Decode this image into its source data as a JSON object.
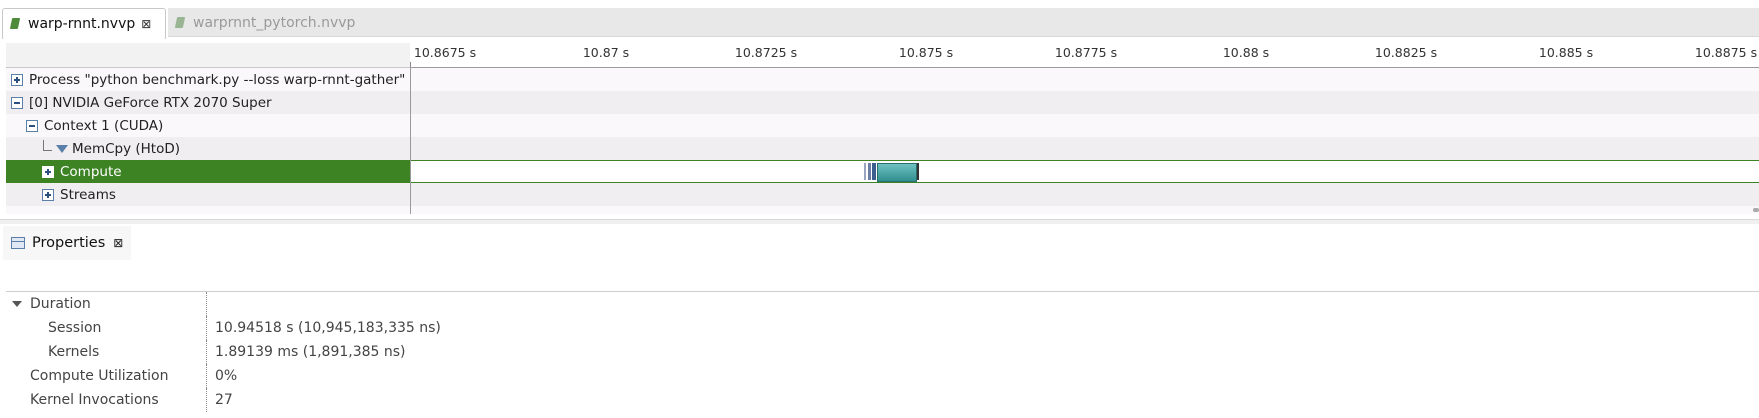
{
  "tabs": [
    {
      "label": "warp-rnnt.nvvp",
      "close": "⊠",
      "icon": "nvvp-file-icon"
    },
    {
      "label": "warprnnt_pytorch.nvvp",
      "icon": "nvvp-file-icon"
    }
  ],
  "ruler": {
    "ticks": [
      "10.8675 s",
      "10.87 s",
      "10.8725 s",
      "10.875 s",
      "10.8775 s",
      "10.88 s",
      "10.8825 s",
      "10.885 s",
      "10.8875 s"
    ]
  },
  "tree": {
    "process": "Process \"python benchmark.py --loss warp-rnnt-gather\" ...",
    "gpu": "[0] NVIDIA GeForce RTX 2070 Super",
    "context": "Context 1 (CUDA)",
    "memcpy": "MemCpy (HtoD)",
    "compute": "Compute",
    "streams": "Streams"
  },
  "properties": {
    "title": "Properties",
    "close": "⊠",
    "rows": [
      {
        "key": "Duration",
        "value": ""
      },
      {
        "key": "Session",
        "value": "10.94518 s (10,945,183,335 ns)"
      },
      {
        "key": "Kernels",
        "value": "1.89139 ms (1,891,385 ns)"
      },
      {
        "key": "Compute Utilization",
        "value": "0%"
      },
      {
        "key": "Kernel Invocations",
        "value": "27"
      }
    ]
  },
  "colors": {
    "selected_row": "#3d8324",
    "kernel": "#3f9f9f",
    "tree_icon": "#5a7fa8"
  }
}
